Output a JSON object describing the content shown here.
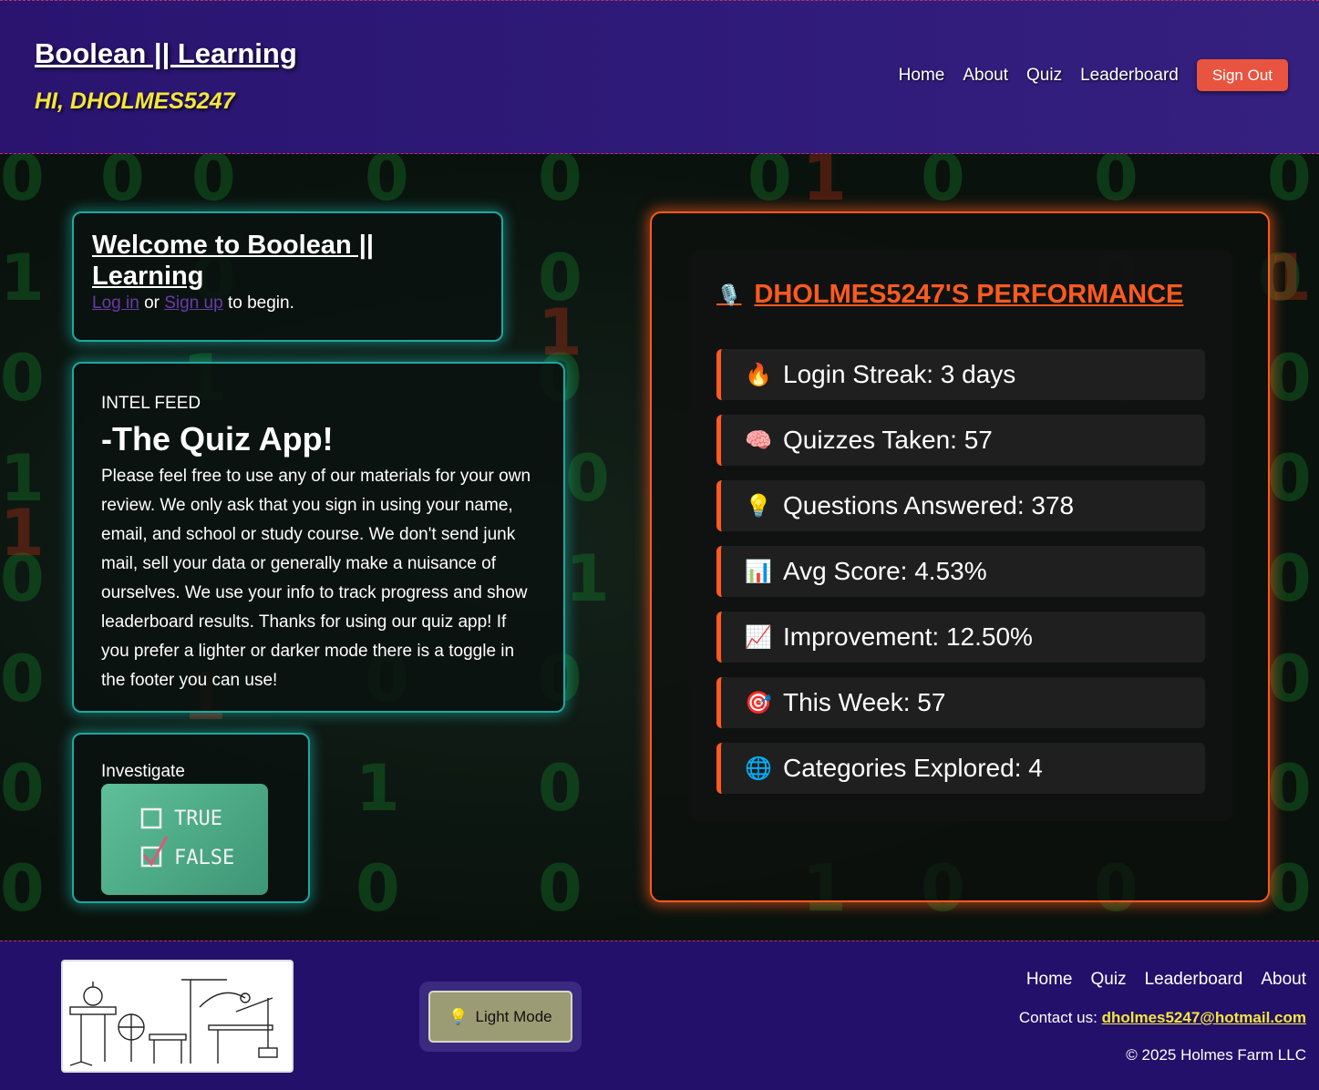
{
  "header": {
    "brand": "Boolean || Learning",
    "greeting": "HI, DHOLMES5247",
    "nav": [
      "Home",
      "About",
      "Quiz",
      "Leaderboard"
    ],
    "sign_out": "Sign Out"
  },
  "welcome": {
    "title": "Welcome to Boolean || Learning",
    "login_link": "Log in",
    "or": "or",
    "signup_link": "Sign up",
    "suffix": "to begin."
  },
  "intel": {
    "label": "INTEL FEED",
    "title": "-The Quiz App!",
    "body": "Please feel free to use any of our materials for your own review. We only ask that you sign in using your name, email, and school or study course. We don't send junk mail, sell your data or generally make a nuisance of ourselves. We use your info to track progress and show leaderboard results. Thanks for using our quiz app! If you prefer a lighter or darker mode there is a toggle in the footer you can use!"
  },
  "investigate": {
    "label": "Investigate",
    "chalk_true": "TRUE",
    "chalk_false": "FALSE"
  },
  "performance": {
    "title": "DHOLMES5247'S PERFORMANCE",
    "title_icon": "microphone-icon",
    "stats": [
      {
        "icon": "🔥",
        "icon_name": "fire-icon",
        "text": "Login Streak: 3 days"
      },
      {
        "icon": "🧠",
        "icon_name": "brain-icon",
        "text": "Quizzes Taken: 57"
      },
      {
        "icon": "💡",
        "icon_name": "lightbulb-icon",
        "text": "Questions Answered: 378"
      },
      {
        "icon": "📊",
        "icon_name": "bar-chart-icon",
        "text": "Avg Score: 4.53%"
      },
      {
        "icon": "📈",
        "icon_name": "trend-up-icon",
        "text": "Improvement: 12.50%"
      },
      {
        "icon": "🎯",
        "icon_name": "target-icon",
        "text": "This Week: 57"
      },
      {
        "icon": "🌐",
        "icon_name": "globe-icon",
        "text": "Categories Explored: 4"
      }
    ]
  },
  "footer": {
    "mode_button": "Light Mode",
    "mode_icon": "💡",
    "nav": [
      "Home",
      "Quiz",
      "Leaderboard",
      "About"
    ],
    "contact_label": "Contact us:",
    "contact_email": "dholmes5247@hotmail.com",
    "copyright": "© 2025 Holmes Farm LLC"
  },
  "colors": {
    "header_bg": "#2e1a78",
    "greeting": "#f5e63a",
    "sign_out": "#e8543f",
    "teal_glow": "#1fa8a0",
    "orange_accent": "#ff5a1f",
    "footer_bg": "#23106a"
  }
}
